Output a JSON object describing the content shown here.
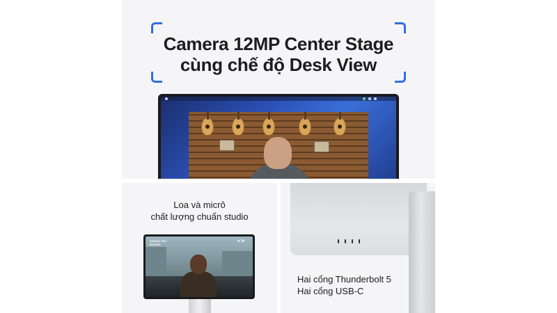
{
  "headline": {
    "line1": "Camera 12MP Center Stage",
    "line2": "cùng chế độ Desk View"
  },
  "audio_card": {
    "line1": "Loa và micrô",
    "line2": "chất lượng chuẩn studio",
    "tv_logo": "tv",
    "tv_title_line1": "KHÔNG TÁC",
    "tv_title_line2": "ĐƯỜNG"
  },
  "ports_card": {
    "line1": "Hai cổng Thunderbolt 5",
    "line2": "Hai cổng USB-C"
  },
  "colors": {
    "page_background": "#ffffff",
    "card_background": "#f5f5f7",
    "text": "#1d1d1f",
    "bracket_accent": "#2f6fe0"
  },
  "icons": [
    "apple-tv-icon",
    "thunderbolt-port-icon",
    "usb-c-port-icon"
  ]
}
